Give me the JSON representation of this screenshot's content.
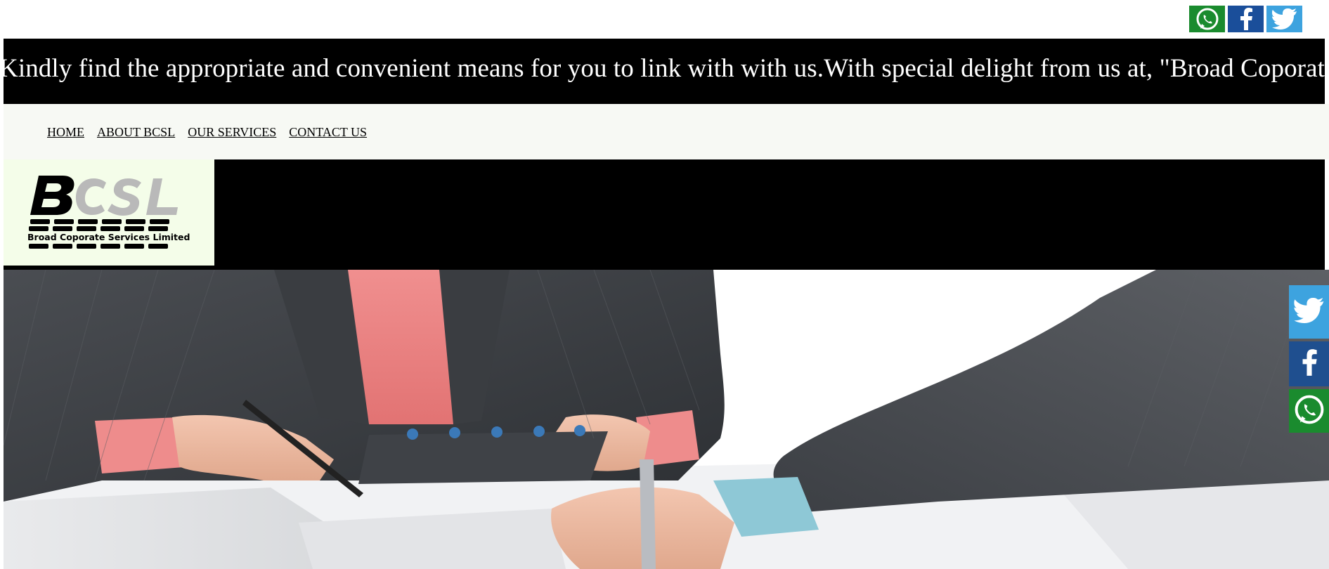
{
  "top_social": {
    "icons": [
      "whatsapp-icon",
      "facebook-icon",
      "twitter-icon"
    ]
  },
  "marquee": {
    "text": "Kindly find the appropriate and convenient means for you to link with with us.With special delight from us at, \"Broad Coporate Services Limited\""
  },
  "nav": {
    "items": [
      {
        "label": "HOME"
      },
      {
        "label": "ABOUT BCSL"
      },
      {
        "label": "OUR SERVICES"
      },
      {
        "label": "CONTACT US"
      }
    ]
  },
  "logo": {
    "letters": "BCSL",
    "tagline": "Broad Coporate Services Limited"
  },
  "side_social": {
    "icons": [
      "twitter-icon",
      "facebook-icon",
      "whatsapp-icon"
    ]
  },
  "colors": {
    "whatsapp": "#1a8b2e",
    "facebook": "#1a4e9a",
    "twitter": "#3da3df",
    "band": "#000000",
    "nav_bg": "#f7f9f4",
    "logo_bg": "#f4fde9"
  }
}
